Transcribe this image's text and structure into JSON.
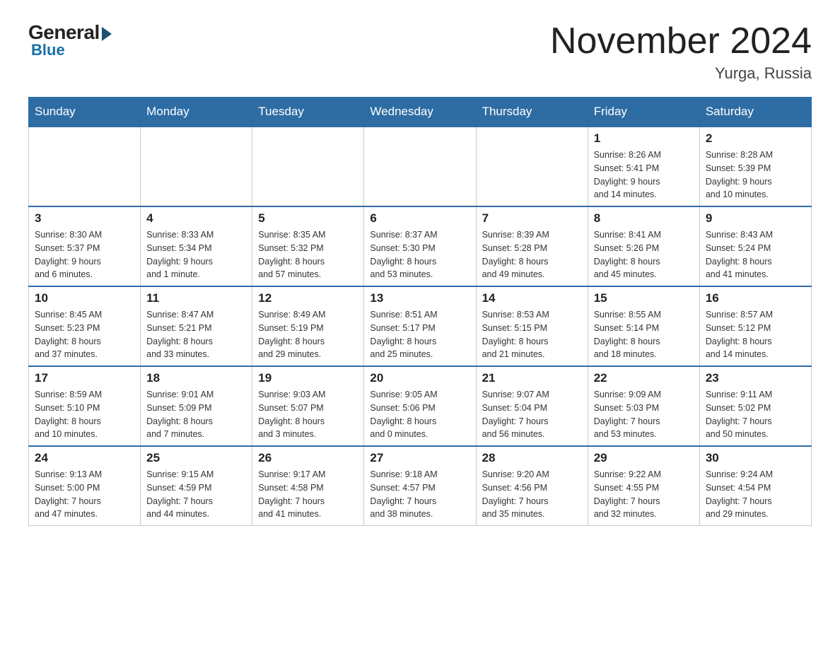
{
  "header": {
    "logo_general": "General",
    "logo_blue": "Blue",
    "month_title": "November 2024",
    "location": "Yurga, Russia"
  },
  "days_of_week": [
    "Sunday",
    "Monday",
    "Tuesday",
    "Wednesday",
    "Thursday",
    "Friday",
    "Saturday"
  ],
  "weeks": [
    [
      {
        "day": "",
        "info": ""
      },
      {
        "day": "",
        "info": ""
      },
      {
        "day": "",
        "info": ""
      },
      {
        "day": "",
        "info": ""
      },
      {
        "day": "",
        "info": ""
      },
      {
        "day": "1",
        "info": "Sunrise: 8:26 AM\nSunset: 5:41 PM\nDaylight: 9 hours\nand 14 minutes."
      },
      {
        "day": "2",
        "info": "Sunrise: 8:28 AM\nSunset: 5:39 PM\nDaylight: 9 hours\nand 10 minutes."
      }
    ],
    [
      {
        "day": "3",
        "info": "Sunrise: 8:30 AM\nSunset: 5:37 PM\nDaylight: 9 hours\nand 6 minutes."
      },
      {
        "day": "4",
        "info": "Sunrise: 8:33 AM\nSunset: 5:34 PM\nDaylight: 9 hours\nand 1 minute."
      },
      {
        "day": "5",
        "info": "Sunrise: 8:35 AM\nSunset: 5:32 PM\nDaylight: 8 hours\nand 57 minutes."
      },
      {
        "day": "6",
        "info": "Sunrise: 8:37 AM\nSunset: 5:30 PM\nDaylight: 8 hours\nand 53 minutes."
      },
      {
        "day": "7",
        "info": "Sunrise: 8:39 AM\nSunset: 5:28 PM\nDaylight: 8 hours\nand 49 minutes."
      },
      {
        "day": "8",
        "info": "Sunrise: 8:41 AM\nSunset: 5:26 PM\nDaylight: 8 hours\nand 45 minutes."
      },
      {
        "day": "9",
        "info": "Sunrise: 8:43 AM\nSunset: 5:24 PM\nDaylight: 8 hours\nand 41 minutes."
      }
    ],
    [
      {
        "day": "10",
        "info": "Sunrise: 8:45 AM\nSunset: 5:23 PM\nDaylight: 8 hours\nand 37 minutes."
      },
      {
        "day": "11",
        "info": "Sunrise: 8:47 AM\nSunset: 5:21 PM\nDaylight: 8 hours\nand 33 minutes."
      },
      {
        "day": "12",
        "info": "Sunrise: 8:49 AM\nSunset: 5:19 PM\nDaylight: 8 hours\nand 29 minutes."
      },
      {
        "day": "13",
        "info": "Sunrise: 8:51 AM\nSunset: 5:17 PM\nDaylight: 8 hours\nand 25 minutes."
      },
      {
        "day": "14",
        "info": "Sunrise: 8:53 AM\nSunset: 5:15 PM\nDaylight: 8 hours\nand 21 minutes."
      },
      {
        "day": "15",
        "info": "Sunrise: 8:55 AM\nSunset: 5:14 PM\nDaylight: 8 hours\nand 18 minutes."
      },
      {
        "day": "16",
        "info": "Sunrise: 8:57 AM\nSunset: 5:12 PM\nDaylight: 8 hours\nand 14 minutes."
      }
    ],
    [
      {
        "day": "17",
        "info": "Sunrise: 8:59 AM\nSunset: 5:10 PM\nDaylight: 8 hours\nand 10 minutes."
      },
      {
        "day": "18",
        "info": "Sunrise: 9:01 AM\nSunset: 5:09 PM\nDaylight: 8 hours\nand 7 minutes."
      },
      {
        "day": "19",
        "info": "Sunrise: 9:03 AM\nSunset: 5:07 PM\nDaylight: 8 hours\nand 3 minutes."
      },
      {
        "day": "20",
        "info": "Sunrise: 9:05 AM\nSunset: 5:06 PM\nDaylight: 8 hours\nand 0 minutes."
      },
      {
        "day": "21",
        "info": "Sunrise: 9:07 AM\nSunset: 5:04 PM\nDaylight: 7 hours\nand 56 minutes."
      },
      {
        "day": "22",
        "info": "Sunrise: 9:09 AM\nSunset: 5:03 PM\nDaylight: 7 hours\nand 53 minutes."
      },
      {
        "day": "23",
        "info": "Sunrise: 9:11 AM\nSunset: 5:02 PM\nDaylight: 7 hours\nand 50 minutes."
      }
    ],
    [
      {
        "day": "24",
        "info": "Sunrise: 9:13 AM\nSunset: 5:00 PM\nDaylight: 7 hours\nand 47 minutes."
      },
      {
        "day": "25",
        "info": "Sunrise: 9:15 AM\nSunset: 4:59 PM\nDaylight: 7 hours\nand 44 minutes."
      },
      {
        "day": "26",
        "info": "Sunrise: 9:17 AM\nSunset: 4:58 PM\nDaylight: 7 hours\nand 41 minutes."
      },
      {
        "day": "27",
        "info": "Sunrise: 9:18 AM\nSunset: 4:57 PM\nDaylight: 7 hours\nand 38 minutes."
      },
      {
        "day": "28",
        "info": "Sunrise: 9:20 AM\nSunset: 4:56 PM\nDaylight: 7 hours\nand 35 minutes."
      },
      {
        "day": "29",
        "info": "Sunrise: 9:22 AM\nSunset: 4:55 PM\nDaylight: 7 hours\nand 32 minutes."
      },
      {
        "day": "30",
        "info": "Sunrise: 9:24 AM\nSunset: 4:54 PM\nDaylight: 7 hours\nand 29 minutes."
      }
    ]
  ]
}
